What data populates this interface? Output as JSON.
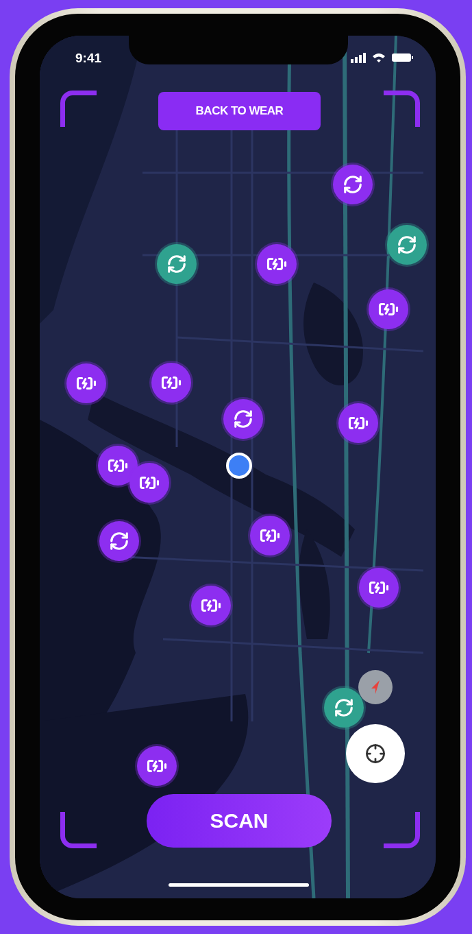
{
  "status_bar": {
    "time": "9:41"
  },
  "top_button": {
    "label": "BACK TO WEAR"
  },
  "pins": [
    {
      "kind": "swap",
      "color": "#8d2ef0"
    },
    {
      "kind": "swap",
      "color": "#2fa28f"
    },
    {
      "kind": "swap",
      "color": "#2fa28f"
    },
    {
      "kind": "charge",
      "color": "#8d2ef0"
    },
    {
      "kind": "charge",
      "color": "#8d2ef0"
    },
    {
      "kind": "charge",
      "color": "#8d2ef0"
    },
    {
      "kind": "charge",
      "color": "#8d2ef0"
    },
    {
      "kind": "swap",
      "color": "#8d2ef0"
    },
    {
      "kind": "charge",
      "color": "#8d2ef0"
    },
    {
      "kind": "charge",
      "color": "#8d2ef0"
    },
    {
      "kind": "charge",
      "color": "#8d2ef0"
    },
    {
      "kind": "swap",
      "color": "#8d2ef0"
    },
    {
      "kind": "charge",
      "color": "#8d2ef0"
    },
    {
      "kind": "charge",
      "color": "#8d2ef0"
    },
    {
      "kind": "charge",
      "color": "#8d2ef0"
    },
    {
      "kind": "swap",
      "color": "#2fa28f"
    },
    {
      "kind": "charge",
      "color": "#8d2ef0"
    }
  ],
  "scan_button": {
    "label": "SCAN"
  }
}
